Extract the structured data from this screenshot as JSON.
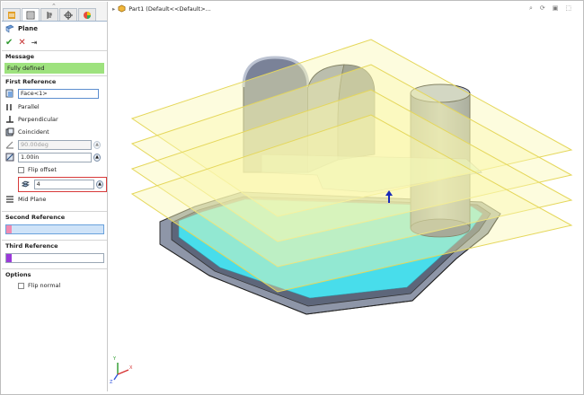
{
  "panel": {
    "tabs": [
      "feature-manager",
      "property-manager",
      "configuration-manager",
      "dim-xpert",
      "display-manager"
    ],
    "title": "Plane",
    "actions": {
      "ok": "✔",
      "cancel": "✕",
      "pin": "⇥"
    },
    "message": {
      "header": "Message",
      "text": "Fully defined"
    },
    "first_reference": {
      "header": "First Reference",
      "selection": "Face<1>",
      "options": [
        "Parallel",
        "Perpendicular",
        "Coincident"
      ],
      "angle": "90.00deg",
      "distance": "1.00in",
      "flip_offset": "Flip offset",
      "count": "4",
      "mid_plane": "Mid Plane"
    },
    "second_reference": {
      "header": "Second Reference",
      "swatch": "#f18ab0"
    },
    "third_reference": {
      "header": "Third Reference",
      "swatch": "#9b39d9"
    },
    "options": {
      "header": "Options",
      "flip_normal": "Flip normal"
    }
  },
  "graphics": {
    "breadcrumb": "Part1 (Default<<Default>..."
  },
  "colors": {
    "plane_fill": "#fbf7b0",
    "plane_edge": "#e5d75b",
    "highlight_face": "#45f2ff",
    "metal": "#8e96a8",
    "accent": "#2a72c9",
    "status_green": "#9ee27e",
    "box_red": "#d83a3a"
  }
}
